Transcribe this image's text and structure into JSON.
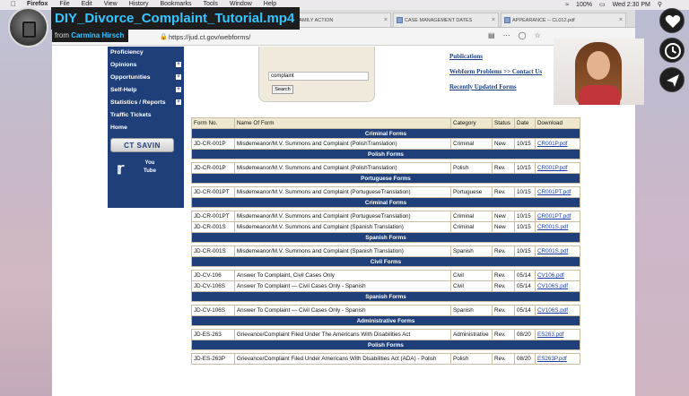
{
  "menubar": {
    "app": "Firefox",
    "items": [
      "File",
      "Edit",
      "View",
      "History",
      "Bookmarks",
      "Tools",
      "Window",
      "Help"
    ],
    "battery": "100%",
    "clock": "Wed 2:30 PM"
  },
  "browser": {
    "tabs": [
      {
        "label": "... -- FAMILY ACTION"
      },
      {
        "label": "CASE MANAGEMENT DATES"
      },
      {
        "label": "APPEARANCE -- CL012.pdf"
      }
    ],
    "url": "https://jud.ct.gov/webforms/"
  },
  "leftnav": {
    "items": [
      "Proficiency",
      "Opinions",
      "Opportunities",
      "Self-Help",
      "Statistics / Reports",
      "Traffic Tickets",
      "Home"
    ],
    "savin": "CT SAVIN",
    "youtube": "You Tube"
  },
  "search": {
    "value": "complaint",
    "button": "Search"
  },
  "sidelinks": [
    "Publications",
    "Webform Problems >> Contact Us",
    "Recently Updated Forms"
  ],
  "table": {
    "headers": [
      "Form No.",
      "Name Of Form",
      "Category",
      "Status",
      "Date",
      "Download"
    ],
    "rows": [
      {
        "section": "Criminal Forms"
      },
      {
        "form_no": "JD-CR-001P",
        "name": "Misdemeanor/M.V. Summons and Complaint (PolishTranslation)",
        "category": "Criminal",
        "status": "New",
        "date": "10/15",
        "download": "CR001P.pdf"
      },
      {
        "section": "Polish Forms"
      },
      {
        "gap": true
      },
      {
        "form_no": "JD-CR-001P",
        "name": "Misdemeanor/M.V. Summons and Complaint (PolishTranslation)",
        "category": "Polish",
        "status": "Rev.",
        "date": "10/15",
        "download": "CR001P.pdf"
      },
      {
        "section": "Portuguese Forms"
      },
      {
        "gap": true
      },
      {
        "form_no": "JD-CR-001PT",
        "name": "Misdemeanor/M.V. Summons and Complaint (PortugueseTranslation)",
        "category": "Portuguese",
        "status": "Rev.",
        "date": "10/15",
        "download": "CR001PT.pdf"
      },
      {
        "section": "Criminal Forms"
      },
      {
        "gap": true
      },
      {
        "form_no": "JD-CR-001PT",
        "name": "Misdemeanor/M.V. Summons and Complaint (PortugueseTranslation)",
        "category": "Criminal",
        "status": "New",
        "date": "10/15",
        "download": "CR001PT.pdf"
      },
      {
        "form_no": "JD-CR-001S",
        "name": "Misdemeanor/M.V. Summons and Complaint (Spanish Translation)",
        "category": "Criminal",
        "status": "New",
        "date": "10/15",
        "download": "CR001S.pdf"
      },
      {
        "section": "Spanish Forms"
      },
      {
        "gap": true
      },
      {
        "form_no": "JD-CR-001S",
        "name": "Misdemeanor/M.V. Summons and Complaint (Spanish Translation)",
        "category": "Spanish",
        "status": "Rev.",
        "date": "10/15",
        "download": "CR001S.pdf"
      },
      {
        "section": "Civil Forms"
      },
      {
        "gap": true
      },
      {
        "form_no": "JD-CV-106",
        "name": "Answer To Complaint, Civil Cases Only",
        "category": "Civil",
        "status": "Rev.",
        "date": "05/14",
        "download": "CV106.pdf"
      },
      {
        "form_no": "JD-CV-106S",
        "name": "Answer To Complaint — Civil Cases Only - Spanish",
        "category": "Civil",
        "status": "Rev.",
        "date": "05/14",
        "download": "CV106S.pdf"
      },
      {
        "section": "Spanish Forms"
      },
      {
        "gap": true
      },
      {
        "form_no": "JD-CV-106S",
        "name": "Answer To Complaint — Civil Cases Only - Spanish",
        "category": "Spanish",
        "status": "Rev.",
        "date": "05/14",
        "download": "CV106S.pdf"
      },
      {
        "section": "Administrative Forms"
      },
      {
        "gap": true
      },
      {
        "form_no": "JD-ES-263",
        "name": "Grievance/Complaint Filed Under The Americans With Disabilities Act",
        "category": "Administrative",
        "status": "Rev.",
        "date": "08/20",
        "download": "ES263.pdf"
      },
      {
        "section": "Polish Forms"
      },
      {
        "gap": true
      },
      {
        "form_no": "JD-ES-263P",
        "name": "Grievance/Complaint Filed Under Americans With Disabilities Act (ADA) - Polish",
        "category": "Polish",
        "status": "Rev.",
        "date": "08/20",
        "download": "ES263P.pdf"
      }
    ]
  },
  "overlay": {
    "title": "DIY_Divorce_Complaint_Tutorial.mp4",
    "from_label": "from",
    "author": "Carmina Hirsch",
    "buttons": [
      "heart-icon",
      "clock-icon",
      "send-icon"
    ]
  }
}
